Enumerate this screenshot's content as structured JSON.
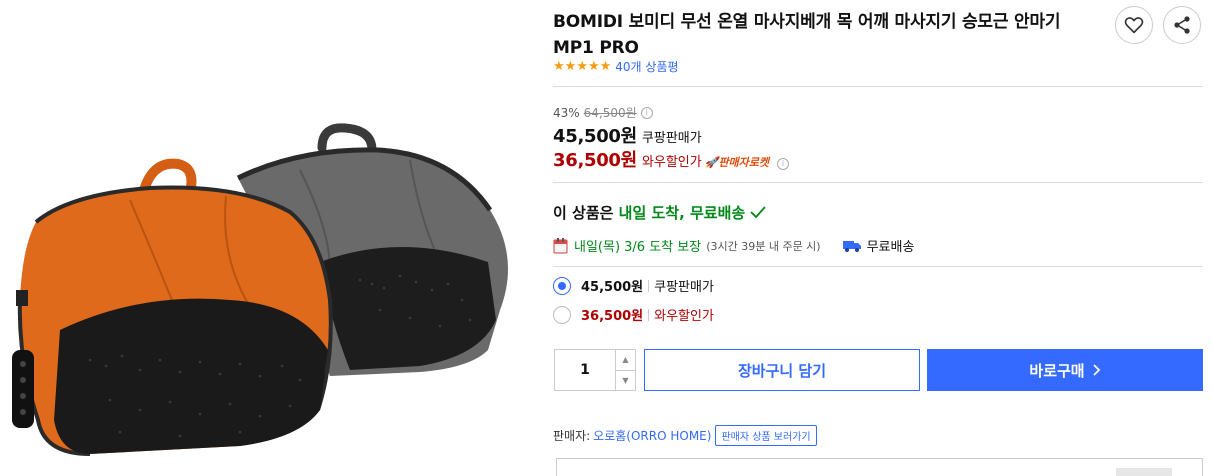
{
  "product": {
    "title": "BOMIDI 보미디 무선 온열 마사지베개 목 어깨 마사지기 승모근 안마기 MP1 PRO",
    "review_count": "40개 상품평",
    "rating_stars": 5
  },
  "price": {
    "discount_rate": "43%",
    "original": "64,500원",
    "coupang": "45,500원",
    "coupang_label": "쿠팡판매가",
    "wow": "36,500원",
    "wow_label": "와우할인가",
    "rocket_badge": "판매자로켓"
  },
  "delivery": {
    "headline_prefix": "이 상품은 ",
    "headline_green": "내일 도착, 무료배송",
    "arrival_date": "내일(목) 3/6 도착 보장",
    "arrival_note": "(3시간 39분 내 주문 시)",
    "free_shipping": "무료배송"
  },
  "options": [
    {
      "price": "45,500원",
      "label": "쿠팡판매가",
      "selected": true
    },
    {
      "price": "36,500원",
      "label": "와우할인가",
      "selected": false
    }
  ],
  "purchase": {
    "quantity": "1",
    "cart_label": "장바구니 담기",
    "buy_label": "바로구매"
  },
  "seller": {
    "prefix": "판매자:",
    "name": "오로홈(ORRO HOME)",
    "link_label": "판매자 상품 보러가기"
  },
  "colors": {
    "brand_blue": "#346aff",
    "wow_red": "#ae0000",
    "delivery_green": "#00891a",
    "star_orange": "#f39c12"
  }
}
